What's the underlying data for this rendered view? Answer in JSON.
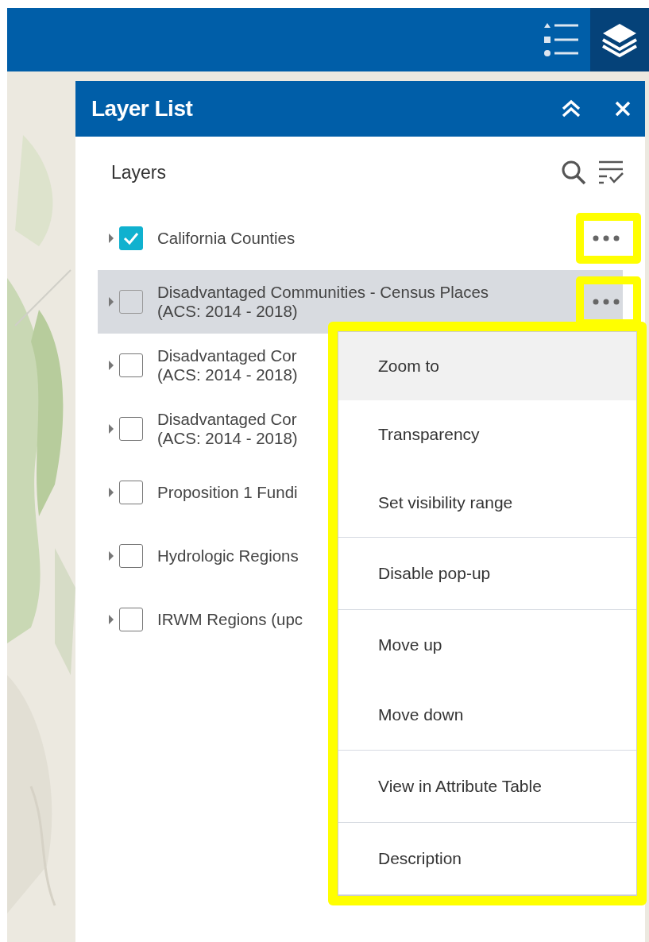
{
  "panel": {
    "title": "Layer List"
  },
  "section": {
    "title": "Layers"
  },
  "layers": [
    {
      "lines": [
        "California Counties"
      ],
      "checked": true,
      "selected": false,
      "options_highlighted": true
    },
    {
      "lines": [
        "Disadvantaged Communities - Census Places",
        "(ACS: 2014 - 2018)"
      ],
      "checked": false,
      "selected": true,
      "options_highlighted": true
    },
    {
      "lines": [
        "Disadvantaged Cor",
        "(ACS: 2014 - 2018)"
      ],
      "checked": false,
      "selected": false
    },
    {
      "lines": [
        "Disadvantaged Cor",
        "(ACS: 2014 - 2018)"
      ],
      "checked": false,
      "selected": false
    },
    {
      "lines": [
        "Proposition 1 Fundi"
      ],
      "checked": false,
      "selected": false
    },
    {
      "lines": [
        "Hydrologic Regions"
      ],
      "checked": false,
      "selected": false
    },
    {
      "lines": [
        "IRWM Regions (upc"
      ],
      "checked": false,
      "selected": false
    }
  ],
  "menu": {
    "highlighted": true,
    "groups": [
      [
        {
          "label": "Zoom to",
          "selected": true
        },
        {
          "label": "Transparency",
          "selected": false
        },
        {
          "label": "Set visibility range",
          "selected": false
        }
      ],
      [
        {
          "label": "Disable pop-up",
          "selected": false
        }
      ],
      [
        {
          "label": "Move up",
          "selected": false
        },
        {
          "label": "Move down",
          "selected": false
        }
      ],
      [
        {
          "label": "View in Attribute Table",
          "selected": false
        }
      ],
      [
        {
          "label": "Description",
          "selected": false
        }
      ]
    ]
  }
}
